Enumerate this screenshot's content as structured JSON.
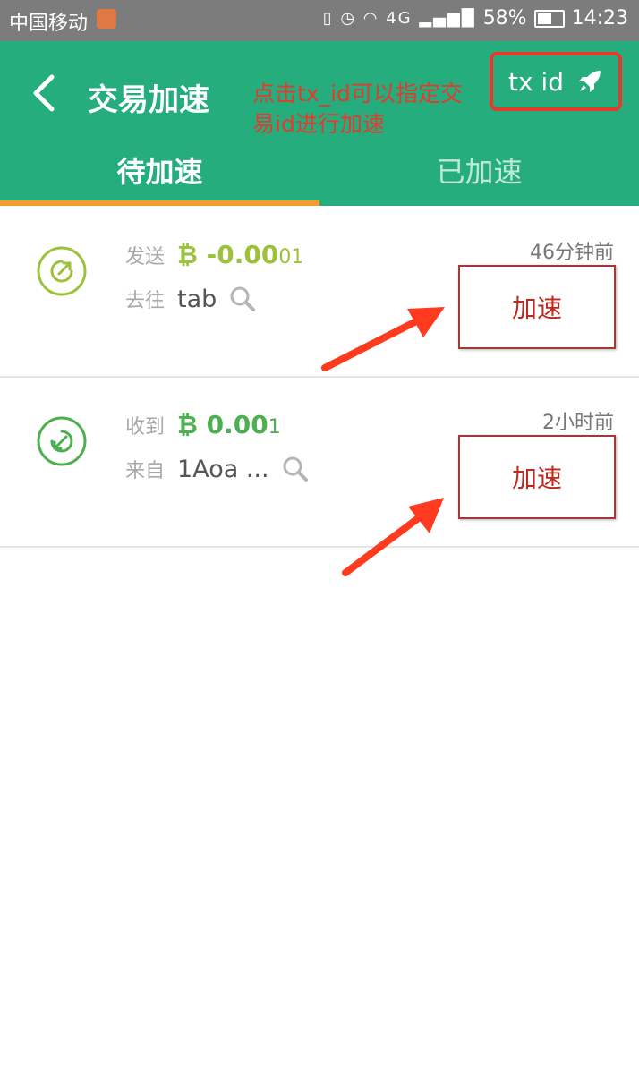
{
  "status_bar": {
    "carrier": "中国移动",
    "network": "4G",
    "battery": "58%",
    "battery_level": 0.58,
    "time": "14:23"
  },
  "header": {
    "title": "交易加速",
    "annotation": "点击tx_id可以指定交易id进行加速",
    "txid_label": "tx id",
    "txid_icon": "rocket-icon"
  },
  "tabs": [
    {
      "label": "待加速",
      "active": true
    },
    {
      "label": "已加速",
      "active": false
    }
  ],
  "transactions": [
    {
      "direction_label": "发送",
      "currency_symbol": "₿",
      "amount_main": "-0.00",
      "amount_tail": "01",
      "peer_label": "去往",
      "peer": "tab",
      "time": "46分钟前",
      "action_label": "加速",
      "icon": "outgoing-arrow-icon",
      "color": "#9cc23c"
    },
    {
      "direction_label": "收到",
      "currency_symbol": "₿",
      "amount_main": "0.00",
      "amount_tail": "1",
      "peer_label": "来自",
      "peer": "1Aoa ...",
      "time": "2小时前",
      "action_label": "加速",
      "icon": "incoming-arrow-icon",
      "color": "#4caf50"
    }
  ],
  "colors": {
    "primary": "#25ad7d",
    "tab_indicator": "#f39c2f",
    "annotation": "#e53a2c"
  }
}
